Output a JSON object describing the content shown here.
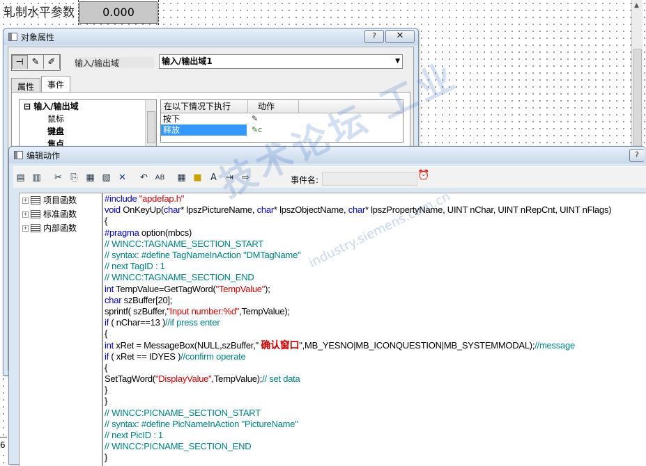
{
  "canvas": {
    "label": "轧制水平参数",
    "io_value": "0.000",
    "edge_text": "6"
  },
  "props_window": {
    "title": "对象属性",
    "help_button": "?",
    "close_button": "✕",
    "object_type": "输入/输出域",
    "object_name": "输入/输出域1",
    "tabs": [
      "属性",
      "事件"
    ],
    "tree": [
      "输入/输出域",
      "鼠标",
      "键盘",
      "焦点"
    ],
    "grid_headers": [
      "在以下情况下执行",
      "动作"
    ],
    "events": [
      {
        "label": "按下",
        "selected": false
      },
      {
        "label": "释放",
        "selected": true
      }
    ]
  },
  "edit_window": {
    "title": "编辑动作",
    "help_button": "?",
    "event_name_label": "事件名:",
    "functions": [
      "项目函数",
      "标准函数",
      "内部函数"
    ],
    "code_lines": [
      [
        [
          "pp",
          "#include "
        ],
        [
          "st",
          "\"apdefap.h\""
        ]
      ],
      [
        [
          "kw",
          "void"
        ],
        [
          "t",
          " OnKeyUp("
        ],
        [
          "kw",
          "char"
        ],
        [
          "t",
          "* lpszPictureName, "
        ],
        [
          "kw",
          "char"
        ],
        [
          "t",
          "* lpszObjectName, "
        ],
        [
          "kw",
          "char"
        ],
        [
          "t",
          "* lpszPropertyName, UINT nChar, UINT nRepCnt, UINT nFlags)"
        ]
      ],
      [
        [
          "t",
          "{"
        ]
      ],
      [
        [
          "kw",
          "#pragma"
        ],
        [
          "t",
          " option(mbcs)"
        ]
      ],
      [
        [
          "cm",
          "// WINCC:TAGNAME_SECTION_START"
        ]
      ],
      [
        [
          "cm",
          "// syntax: #define TagNameInAction \"DMTagName\""
        ]
      ],
      [
        [
          "cm",
          "// next TagID : 1"
        ]
      ],
      [
        [
          "cm",
          "// WINCC:TAGNAME_SECTION_END"
        ]
      ],
      [
        [
          "kw",
          "int"
        ],
        [
          "t",
          " TempValue=GetTagWord("
        ],
        [
          "st",
          "\"TempValue\""
        ],
        [
          "t",
          ");"
        ]
      ],
      [
        [
          "kw",
          "char"
        ],
        [
          "t",
          " szBuffer[20];"
        ]
      ],
      [
        [
          "t",
          "sprintf( szBuffer,"
        ],
        [
          "st",
          "\"Input number:%d\""
        ],
        [
          "t",
          ",TempValue);"
        ]
      ],
      [
        [
          "kw",
          "if"
        ],
        [
          "t",
          " ( nChar==13 )"
        ],
        [
          "cm",
          "//if press enter"
        ]
      ],
      [
        [
          "t",
          "{"
        ]
      ],
      [
        [
          "kw",
          "int"
        ],
        [
          "t",
          " xRet = MessageBox(NULL,szBuffer,\" "
        ],
        [
          "big",
          "确认窗口"
        ],
        [
          "t",
          "\",MB_YESNO|MB_ICONQUESTION|MB_SYSTEMMODAL);"
        ],
        [
          "cm",
          "//message"
        ]
      ],
      [
        [
          "kw",
          "if"
        ],
        [
          "t",
          " ( xRet == IDYES )"
        ],
        [
          "cm",
          "//confirm operate"
        ]
      ],
      [
        [
          "t",
          "{"
        ]
      ],
      [
        [
          "t",
          "SetTagWord("
        ],
        [
          "st",
          "\"DisplayValue\""
        ],
        [
          "t",
          ",TempValue);"
        ],
        [
          "cm",
          "// set data"
        ]
      ],
      [
        [
          "t",
          "}"
        ]
      ],
      [
        [
          "t",
          "}"
        ]
      ],
      [
        [
          "cm",
          "// WINCC:PICNAME_SECTION_START"
        ]
      ],
      [
        [
          "cm",
          "// syntax: #define PicNameInAction \"PictureName\""
        ]
      ],
      [
        [
          "cm",
          "// next PicID : 1"
        ]
      ],
      [
        [
          "cm",
          "// WINCC:PICNAME_SECTION_END"
        ]
      ],
      [
        [
          "t",
          "}"
        ]
      ]
    ]
  },
  "watermark": {
    "main": "技术论坛 工业",
    "url": "industry.siemens.com.cn"
  }
}
